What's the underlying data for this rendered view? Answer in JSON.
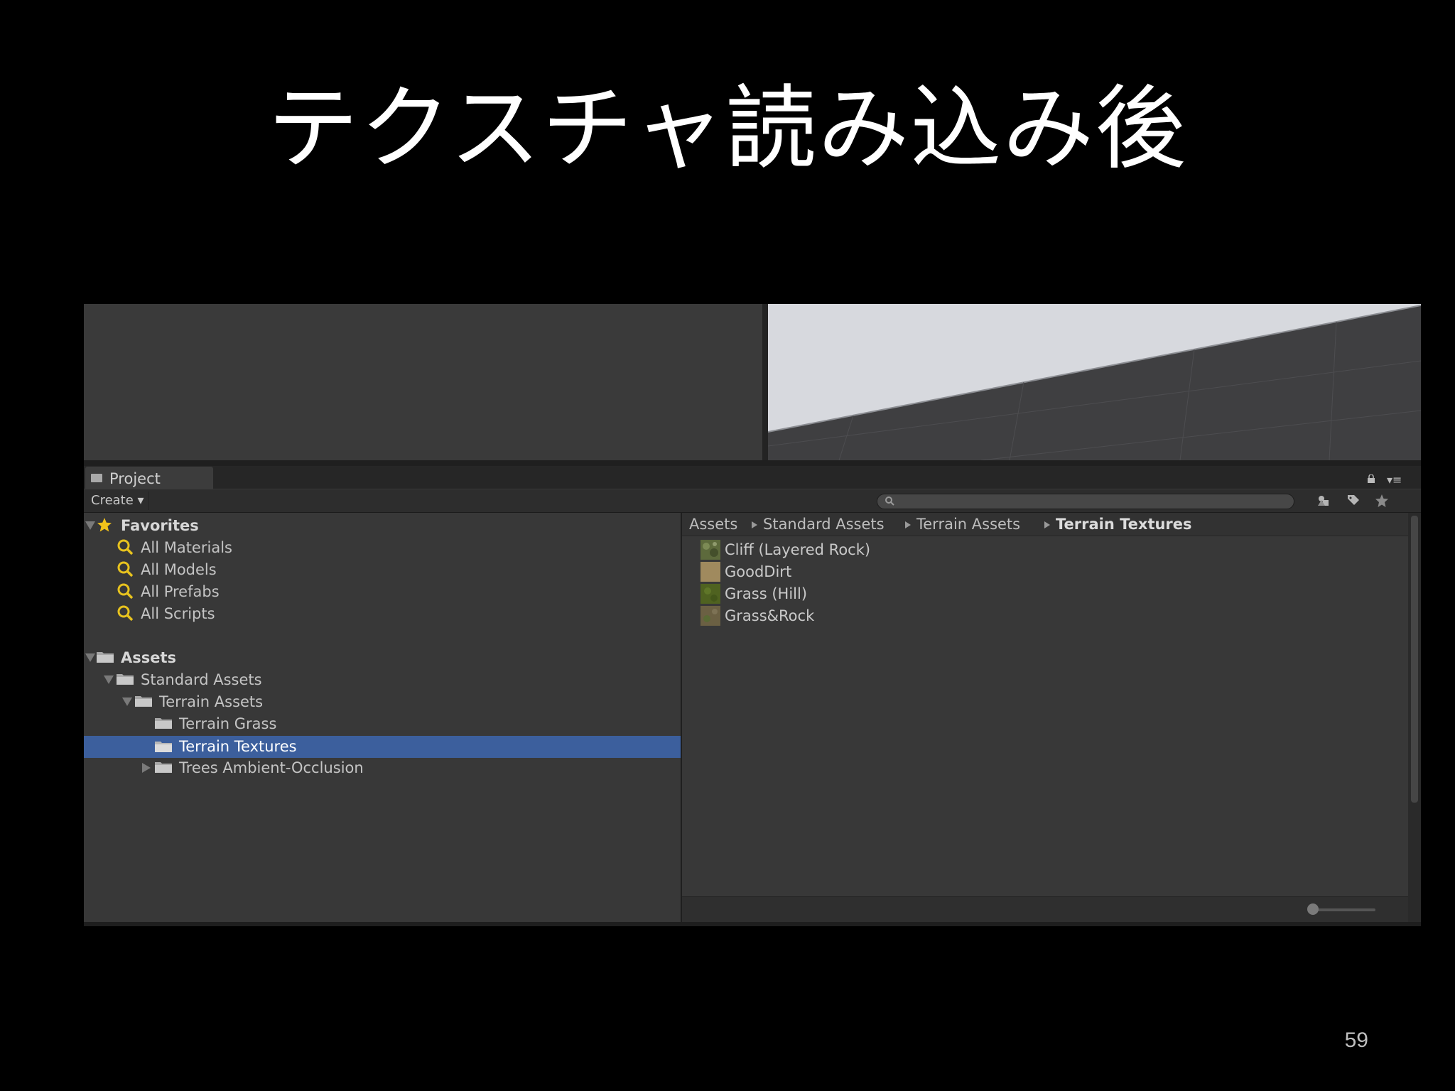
{
  "slide": {
    "title": "テクスチャ読み込み後",
    "page_number": "59"
  },
  "window": {
    "tab_label": "Project",
    "create_label": "Create ▾",
    "search": {
      "placeholder": ""
    }
  },
  "tree": {
    "favorites": {
      "label": "Favorites",
      "items": [
        "All Materials",
        "All Models",
        "All Prefabs",
        "All Scripts"
      ]
    },
    "assets": {
      "label": "Assets",
      "standard_assets": "Standard Assets",
      "terrain_assets": "Terrain Assets",
      "terrain_grass": "Terrain Grass",
      "terrain_textures": "Terrain Textures",
      "trees_ao": "Trees Ambient-Occlusion"
    },
    "selected": "Terrain Textures"
  },
  "breadcrumb": [
    "Assets",
    "Standard Assets",
    "Terrain Assets",
    "Terrain Textures"
  ],
  "content_items": [
    {
      "name": "Cliff (Layered Rock)",
      "color": "#5d6a3c"
    },
    {
      "name": "GoodDirt",
      "color": "#a08a5e"
    },
    {
      "name": "Grass (Hill)",
      "color": "#4f6220"
    },
    {
      "name": "Grass&Rock",
      "color": "#6b6043"
    }
  ],
  "colors": {
    "selection": "#3c5f9d",
    "favorite_star": "#f2c21a",
    "search_icon": "#e8c31e"
  }
}
